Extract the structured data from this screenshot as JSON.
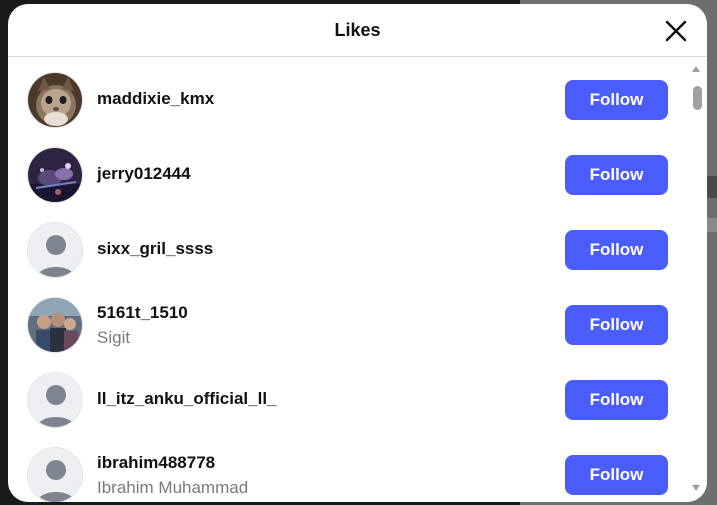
{
  "modal": {
    "title": "Likes",
    "close_icon": "close-icon"
  },
  "colors": {
    "follow_button": "#4a5dfb",
    "username": "#111111",
    "fullname": "#7a7a7a"
  },
  "likes": [
    {
      "username": "maddixie_kmx",
      "fullname": "",
      "follow_label": "Follow",
      "avatar": "photo-cat"
    },
    {
      "username": "jerry012444",
      "fullname": "",
      "follow_label": "Follow",
      "avatar": "photo-night"
    },
    {
      "username": "sixx_gril_ssss",
      "fullname": "",
      "follow_label": "Follow",
      "avatar": "default-avatar"
    },
    {
      "username": "5161t_1510",
      "fullname": "Sigit",
      "follow_label": "Follow",
      "avatar": "photo-group"
    },
    {
      "username": "ll_itz_anku_official_ll_",
      "fullname": "",
      "follow_label": "Follow",
      "avatar": "default-avatar"
    },
    {
      "username": "ibrahim488778",
      "fullname": "Ibrahim Muhammad",
      "follow_label": "Follow",
      "avatar": "default-avatar"
    }
  ]
}
